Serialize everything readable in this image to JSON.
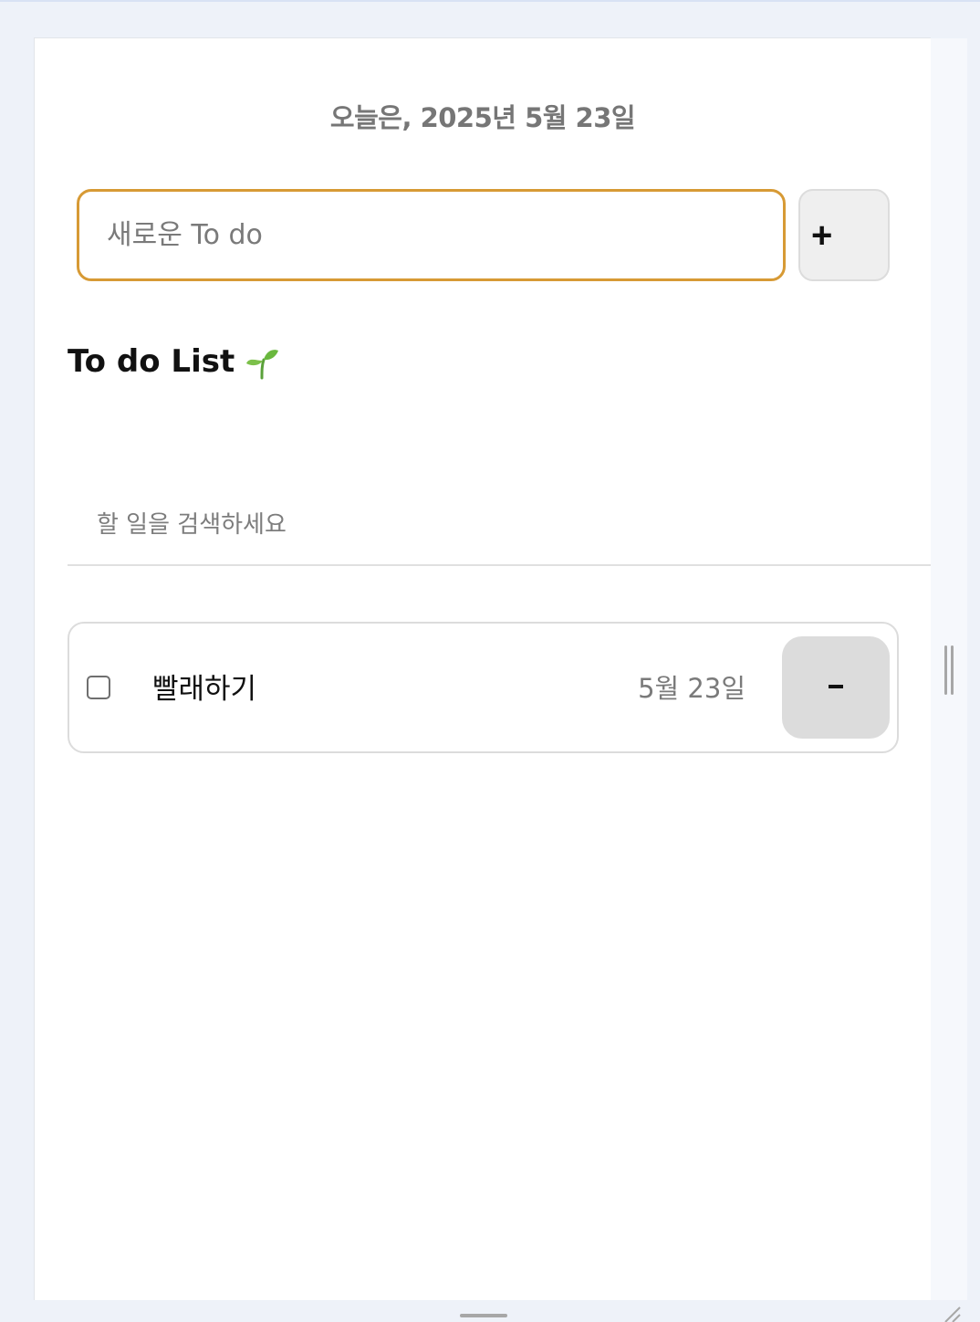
{
  "header": {
    "date_title": "오늘은, 2025년 5월 23일"
  },
  "new_todo": {
    "placeholder": "새로운 To do",
    "add_label": "+"
  },
  "list": {
    "heading": "To do List",
    "heading_icon": "sprout-icon"
  },
  "search": {
    "placeholder": "할 일을 검색하세요"
  },
  "todos": [
    {
      "text": "빨래하기",
      "date": "5월 23일",
      "done": false,
      "delete_label": "-"
    }
  ],
  "colors": {
    "input_border_focus": "#d79a35",
    "button_bg": "#efefef",
    "delete_bg": "#dcdcdc",
    "muted_text": "#7a7a7a",
    "page_bg": "#eef2f9"
  }
}
